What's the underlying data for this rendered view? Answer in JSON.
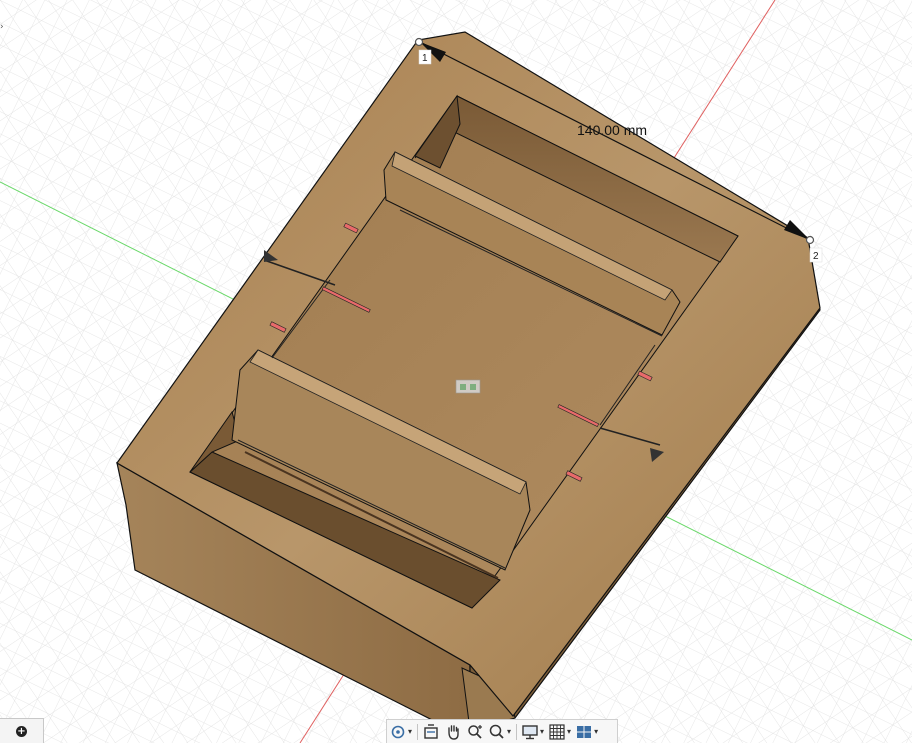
{
  "viewport": {
    "dimension": {
      "value_text": "140.00 mm",
      "point_1": "1",
      "point_2": "2"
    },
    "colors": {
      "grid_line": "#dcdcdc",
      "axis_x": "#e06060",
      "axis_y": "#6ad86a",
      "wood_light": "#b38e60",
      "wood_mid": "#9c7848",
      "wood_dark": "#6e5232",
      "slot_red": "#e86a6a"
    }
  },
  "corner": {
    "chevron": "›"
  },
  "add_button": {
    "label": "+"
  },
  "nav_toolbar": {
    "tools": [
      {
        "name": "orbit",
        "has_dropdown": true
      },
      {
        "name": "look-at",
        "has_dropdown": false
      },
      {
        "name": "pan",
        "has_dropdown": false
      },
      {
        "name": "zoom",
        "has_dropdown": false
      },
      {
        "name": "fit",
        "has_dropdown": true
      },
      {
        "name": "display-settings",
        "has_dropdown": true
      },
      {
        "name": "grid-and-snaps",
        "has_dropdown": true
      },
      {
        "name": "viewports",
        "has_dropdown": true
      }
    ],
    "dropdown_glyph": "▾"
  }
}
